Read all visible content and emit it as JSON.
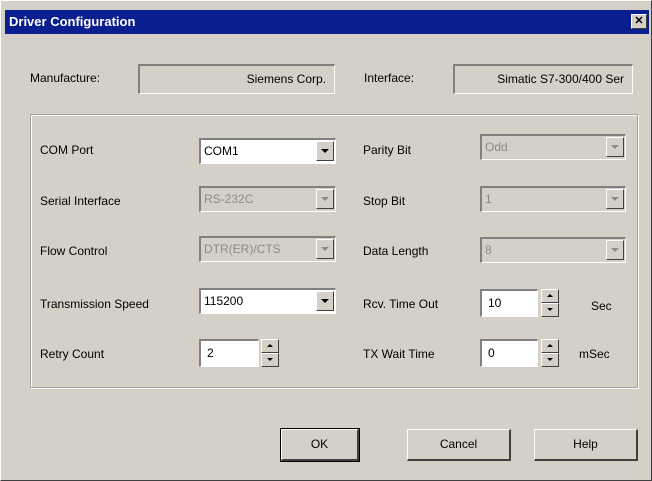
{
  "window": {
    "title": "Driver Configuration",
    "close_glyph": "✕"
  },
  "top": {
    "manufacture_label": "Manufacture:",
    "manufacture_value": "Siemens Corp.",
    "interface_label": "Interface:",
    "interface_value": "Simatic S7-300/400 Ser"
  },
  "fields": {
    "com_port": {
      "label": "COM Port",
      "value": "COM1"
    },
    "serial_interface": {
      "label": "Serial Interface",
      "value": "RS-232C"
    },
    "flow_control": {
      "label": "Flow Control",
      "value": "DTR(ER)/CTS"
    },
    "transmission_speed": {
      "label": "Transmission Speed",
      "value": "115200"
    },
    "retry_count": {
      "label": "Retry Count",
      "value": "2"
    },
    "parity_bit": {
      "label": "Parity Bit",
      "value": "Odd"
    },
    "stop_bit": {
      "label": "Stop Bit",
      "value": "1"
    },
    "data_length": {
      "label": "Data Length",
      "value": "8"
    },
    "rcv_time_out": {
      "label": "Rcv. Time Out",
      "value": "10",
      "unit": "Sec"
    },
    "tx_wait_time": {
      "label": "TX Wait Time",
      "value": "0",
      "unit": "mSec"
    }
  },
  "buttons": {
    "ok": "OK",
    "cancel": "Cancel",
    "help": "Help"
  },
  "colors": {
    "titlebar": "#0a1f8f",
    "face": "#d4d0c8"
  },
  "icons": {
    "close": "close-icon",
    "dropdown": "chevron-down-icon",
    "spin_up": "arrow-up-icon",
    "spin_down": "arrow-down-icon"
  }
}
